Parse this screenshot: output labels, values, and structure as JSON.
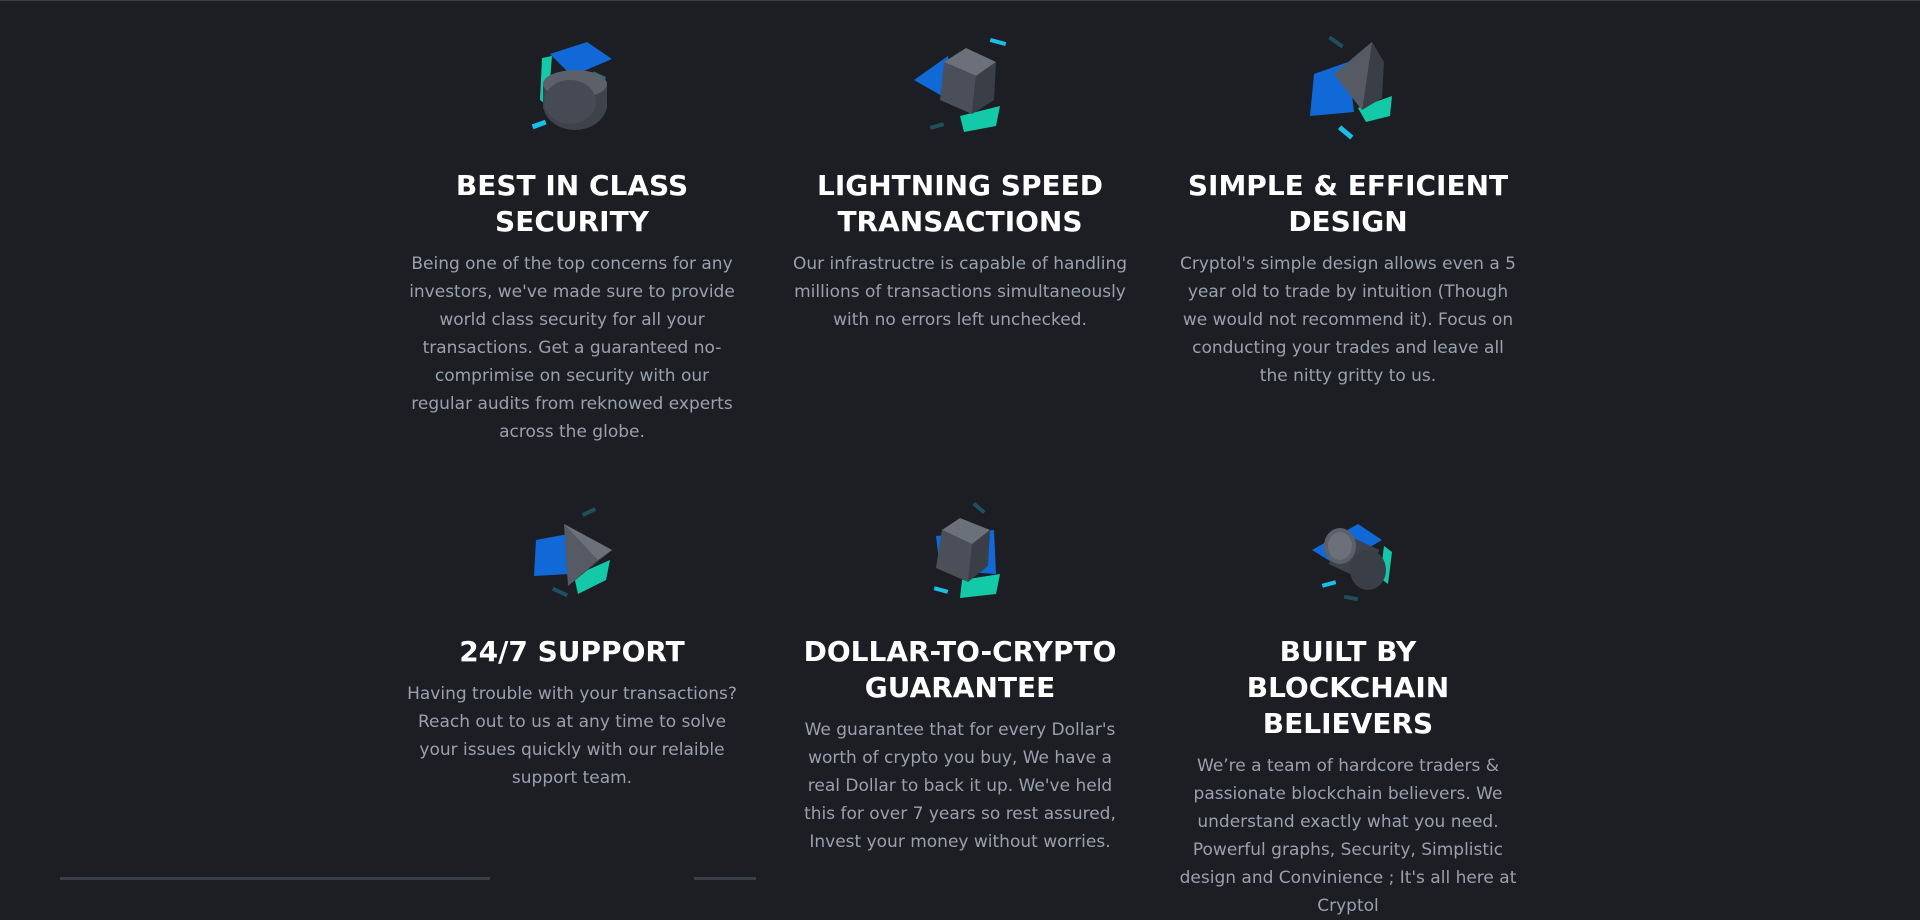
{
  "features": [
    {
      "title": "BEST IN CLASS SECURITY",
      "body": "Being one of the top concerns for any investors, we've made sure to provide world class security for all your transactions. Get a guaranteed no-comprimise on security with our regular audits from reknowed experts across the globe.",
      "icon": "cylinder-icon"
    },
    {
      "title": "LIGHTNING SPEED TRANSACTIONS",
      "body": "Our infrastructre is capable of handling millions of transactions simultaneously with no errors left unchecked.",
      "icon": "cube-icon"
    },
    {
      "title": "SIMPLE & EFFICIENT DESIGN",
      "body": "Cryptol's simple design allows even a 5 year old to trade by intuition (Though we would not recommend it). Focus on conducting your trades and leave all the nitty gritty to us.",
      "icon": "pyramid-icon"
    },
    {
      "title": "24/7 SUPPORT",
      "body": "Having trouble with your transactions? Reach out to us at any time to solve your issues quickly with our relaible support team.",
      "icon": "pyramid-icon"
    },
    {
      "title": "DOLLAR-TO-CRYPTO GUARANTEE",
      "body": "We guarantee that for every Dollar's worth of crypto you buy, We have a real Dollar to back it up. We've held this for over 7 years so rest assured, Invest your money without worries.",
      "icon": "cube-icon"
    },
    {
      "title": "BUILT BY BLOCKCHAIN BELIEVERS",
      "body": "We’re a team of hardcore traders & passionate blockchain believers. We understand exactly what you need. Powerful graphs, Security, Simplistic design and Convinience ; It's all here at Cryptol",
      "icon": "cylinder-icon"
    }
  ],
  "colors": {
    "background": "#1c1e24",
    "title": "#ffffff",
    "body": "#9aa1ad",
    "accent_blue": "#1169d8",
    "accent_teal": "#13c9a8",
    "accent_cyan": "#19bfe8",
    "shape_gray": "#4d525c"
  }
}
